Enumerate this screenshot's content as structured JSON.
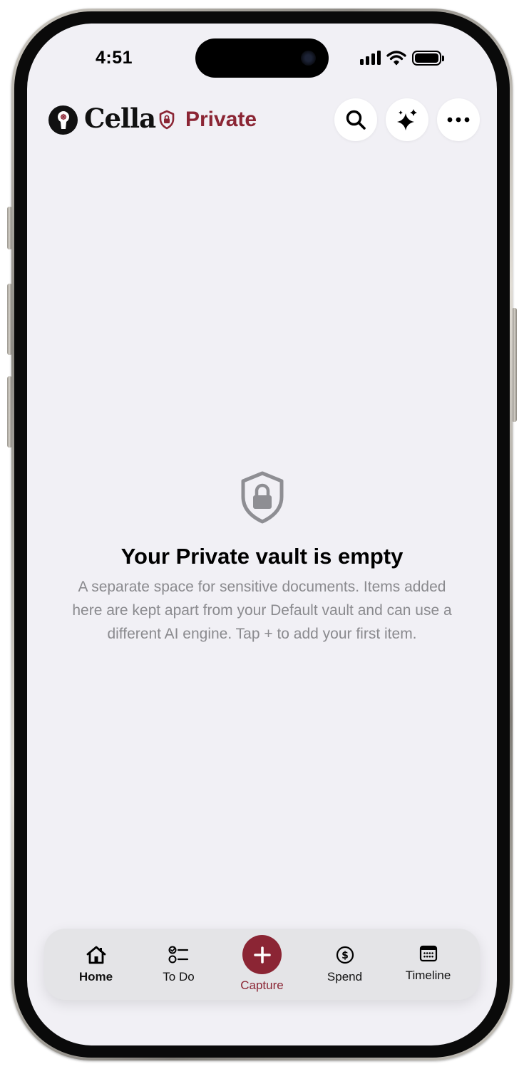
{
  "status_bar": {
    "time": "4:51"
  },
  "header": {
    "app_name": "Cella",
    "vault_name": "Private",
    "accent_color": "#8b2534",
    "actions": [
      {
        "icon": "search-icon"
      },
      {
        "icon": "sparkles-icon"
      },
      {
        "icon": "more-icon"
      }
    ]
  },
  "empty_state": {
    "icon": "shield-lock-icon",
    "title": "Your Private vault is empty",
    "description": "A separate space for sensitive documents. Items added here are kept apart from your Default vault and can use a different AI engine. Tap + to add your first item."
  },
  "tab_bar": {
    "tabs": [
      {
        "label": "Home",
        "icon": "home-icon",
        "selected": true
      },
      {
        "label": "To Do",
        "icon": "checklist-icon"
      },
      {
        "label": "Capture",
        "icon": "plus-icon",
        "accent": true
      },
      {
        "label": "Spend",
        "icon": "dollar-icon"
      },
      {
        "label": "Timeline",
        "icon": "calendar-icon"
      }
    ]
  }
}
